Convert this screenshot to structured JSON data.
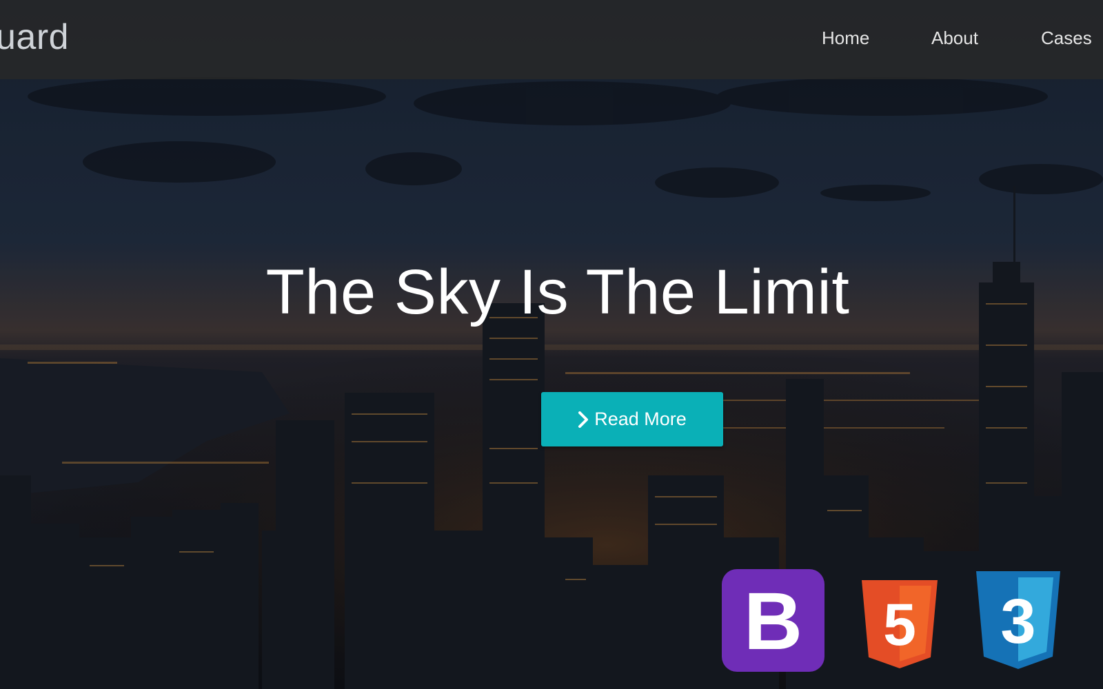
{
  "navbar": {
    "brand": "uard",
    "links": [
      "Home",
      "About",
      "Cases"
    ]
  },
  "hero": {
    "headline": "The Sky Is The Limit",
    "cta_label": "Read More",
    "cta_icon": "chevron-right-icon"
  },
  "logos": {
    "bootstrap_letter": "B",
    "html5_number": "5",
    "css3_number": "3"
  },
  "colors": {
    "accent": "#0ab0b7",
    "bootstrap": "#6f2db7",
    "html5": "#e44d26",
    "css3": "#1572b6"
  }
}
